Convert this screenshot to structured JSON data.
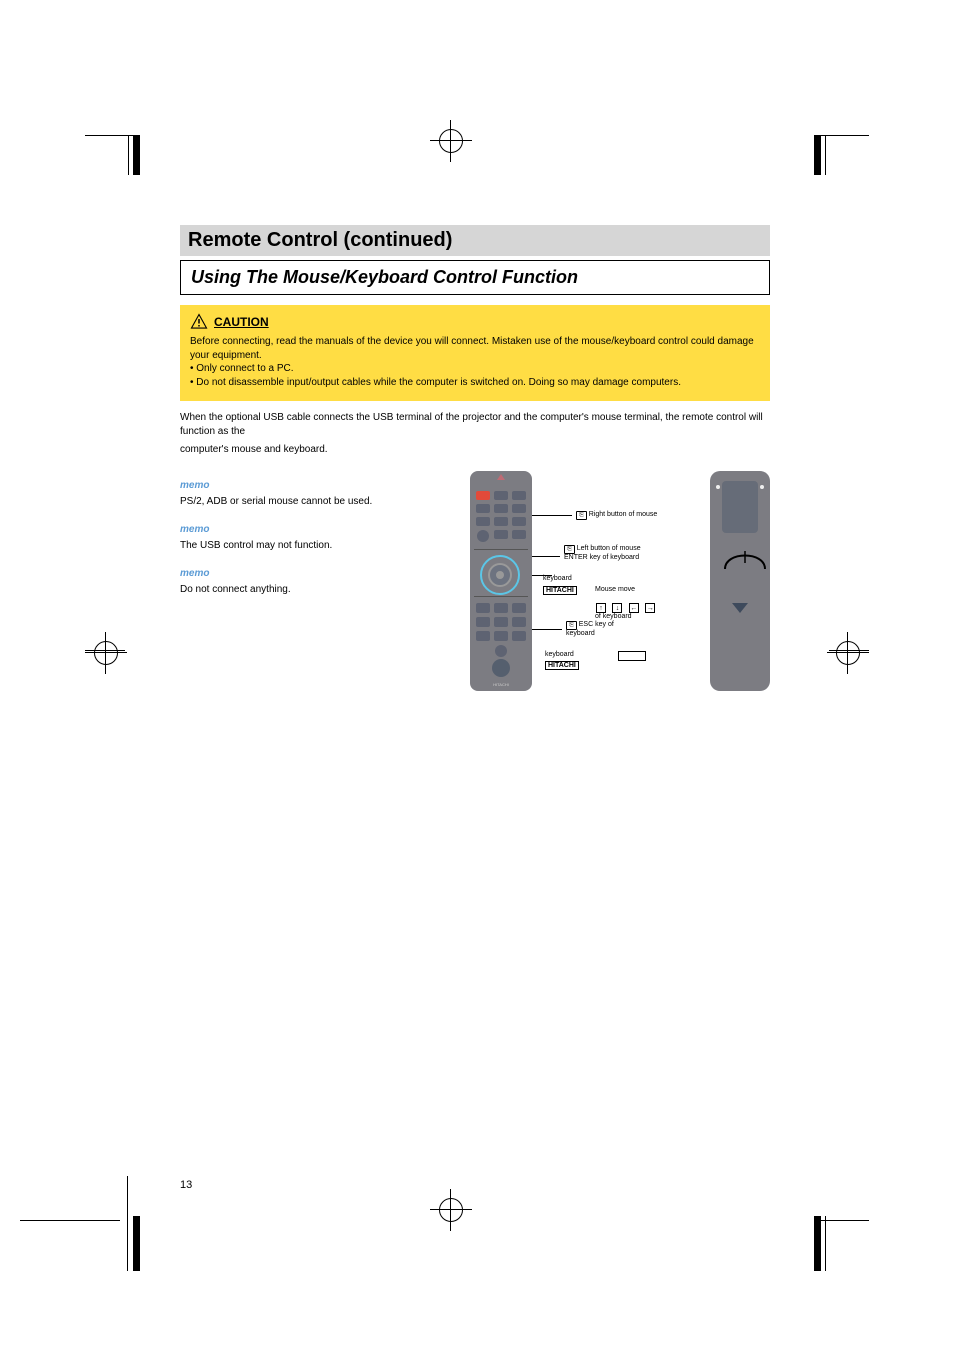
{
  "page": {
    "number": "13"
  },
  "header": {
    "title": "Remote Control (continued)",
    "subtitle": "Using The Mouse/Keyboard Control Function"
  },
  "caution": {
    "label": "CAUTION",
    "line1": "Before connecting, read the manuals of the device you will connect. Mistaken use of the mouse/keyboard control could damage your equipment.",
    "bullet1": "• Only connect to a PC.",
    "bullet2": "• Do not disassemble input/output cables while the computer is switched on. Doing so may damage computers."
  },
  "intro": {
    "line1": "When the optional USB cable connects the USB terminal of the projector and the computer's mouse terminal, the remote control will function as the",
    "line2": "computer's mouse and keyboard."
  },
  "memos": {
    "m1_label": "memo",
    "m1_body": "PS/2, ADB or serial mouse cannot be",
    "m2_label": "memo",
    "m2_body": "The USB control may not",
    "m3_label": "memo",
    "m3_body": "Do not connect",
    "m1_body_2": "used.",
    "m2_body_2": "function.",
    "m3_body_2": "anything."
  },
  "labels": {
    "right_button": "Right button of mouse",
    "left_button_enter": "Left button of mouse",
    "enter_key": "ENTER key of keyboard",
    "brand_keyboard": "keyboard",
    "mouse_move": "Mouse move",
    "arrows_of_keyboard": "of keyboard",
    "esc_key": "ESC key of",
    "esc_key2": "keyboard",
    "brand": "HITACHI",
    "key_up": "↑",
    "key_down": "↓",
    "key_left": "←",
    "key_right": "→"
  }
}
